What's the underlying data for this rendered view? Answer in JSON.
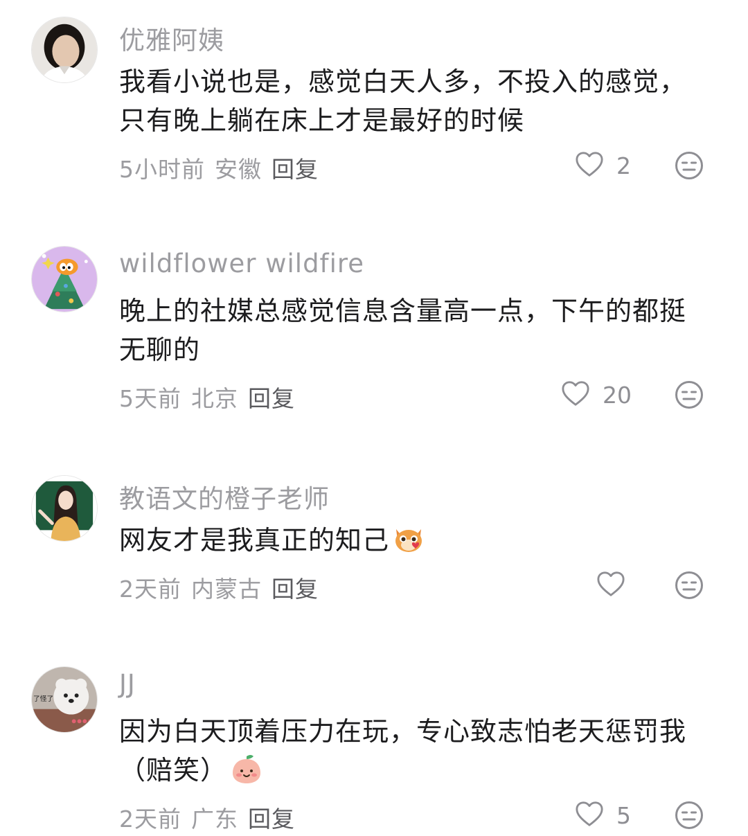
{
  "comments": [
    {
      "username": "优雅阿姨",
      "text": "我看小说也是，感觉白天人多，不投入的感觉，只有晚上躺在床上才是最好的时候",
      "time": "5小时前",
      "location": "安徽",
      "reply": "回复",
      "likes": "2"
    },
    {
      "username": "wildflower wildfire",
      "text": "晚上的社媒总感觉信息含量高一点，下午的都挺无聊的",
      "time": "5天前",
      "location": "北京",
      "reply": "回复",
      "likes": "20"
    },
    {
      "username": "教语文的橙子老师",
      "text": "网友才是我真正的知己",
      "time": "2天前",
      "location": "内蒙古",
      "reply": "回复",
      "likes": ""
    },
    {
      "username": "JJ",
      "text": "因为白天顶着压力在玩，专心致志怕老天惩罚我（赔笑）",
      "time": "2天前",
      "location": "广东",
      "reply": "回复",
      "likes": "5"
    }
  ],
  "avatar_text": "了怪了",
  "icons": {
    "like": "heart-outline-icon",
    "dislike": "meh-face-icon",
    "emoji_cat": "cat-heart-emoji",
    "emoji_peach": "smiling-peach-emoji"
  },
  "colors": {
    "text": "#1c1c1e",
    "secondary": "#9c9ca0",
    "reply": "#5a5a5e",
    "icon": "#8e8e93"
  }
}
